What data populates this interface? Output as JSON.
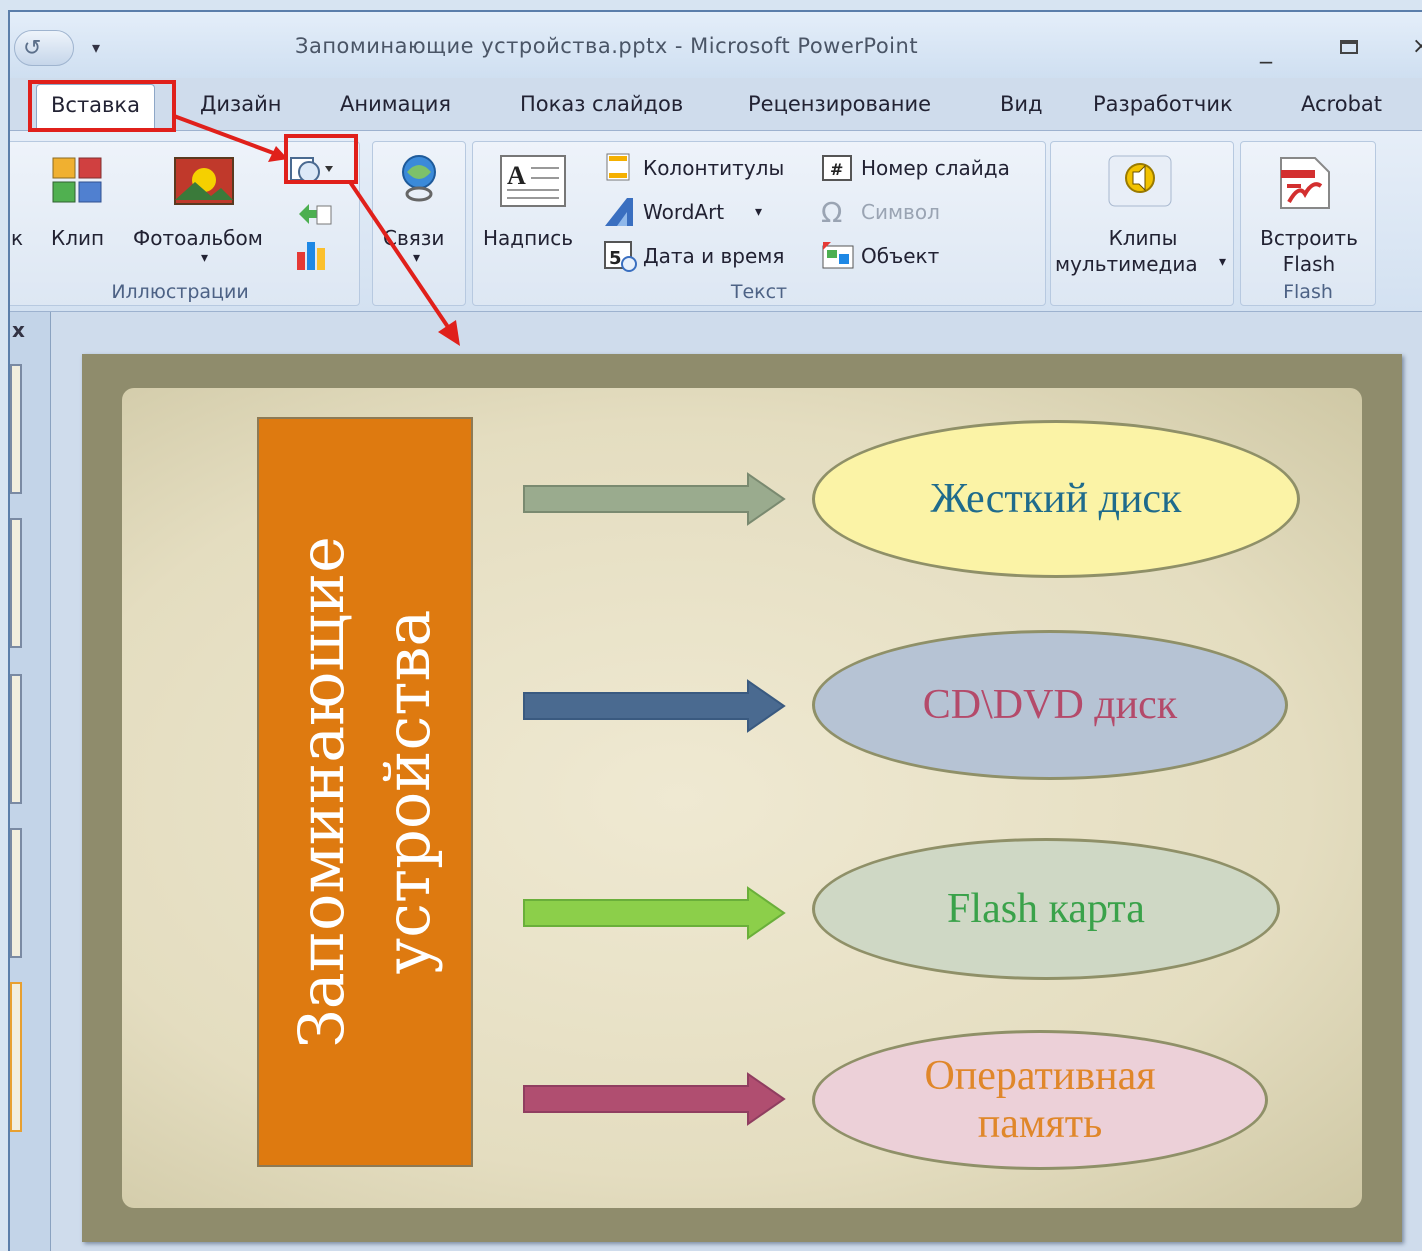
{
  "window": {
    "title": "Запоминающие устройства.pptx - Microsoft PowerPoint",
    "qat_undo": "↺",
    "qat_dropdown": "▾",
    "minimize": "_",
    "close": "×"
  },
  "tabs": [
    {
      "label": "Вставка",
      "active": true
    },
    {
      "label": "Дизайн"
    },
    {
      "label": "Анимация"
    },
    {
      "label": "Показ слайдов"
    },
    {
      "label": "Рецензирование"
    },
    {
      "label": "Вид"
    },
    {
      "label": "Разработчик"
    },
    {
      "label": "Acrobat"
    }
  ],
  "ribbon": {
    "illustrations": {
      "partial_label": "к",
      "clip": "Клип",
      "photoalbum": "Фотоальбом",
      "group_label": "Иллюстрации"
    },
    "links": {
      "label": "Связи"
    },
    "text": {
      "textbox": "Надпись",
      "header_footer": "Колонтитулы",
      "wordart": "WordArt",
      "datetime": "Дата и время",
      "slide_number": "Номер слайда",
      "symbol": "Символ",
      "object": "Объект",
      "group_label": "Текст"
    },
    "media": {
      "label_line1": "Клипы",
      "label_line2": "мультимедиа",
      "dropdown": "▾"
    },
    "flash": {
      "label_line1": "Встроить",
      "label_line2": "Flash",
      "group_label": "Flash"
    }
  },
  "left_pane": {
    "close": "x"
  },
  "slide": {
    "main_box_text": "Запоминающие\nустройства",
    "items": [
      {
        "label": "Жесткий диск",
        "text_color": "#1f6b8c",
        "fill": "#fbf3a6",
        "arrow_color": "#9aab8e"
      },
      {
        "label": "CD\\DVD диск",
        "text_color": "#b44a6a",
        "fill": "#b6c3d4",
        "arrow_color": "#4a6a90"
      },
      {
        "label": "Flash карта",
        "text_color": "#3aa24a",
        "fill": "#cfd8c5",
        "arrow_color": "#8ccf4a"
      },
      {
        "label": "Оперативная\nпамять",
        "text_color": "#e0872a",
        "fill": "#ecd0d8",
        "arrow_color": "#b04e70"
      }
    ],
    "box_color": "#de7a10"
  },
  "annotation_color": "#e0201b"
}
